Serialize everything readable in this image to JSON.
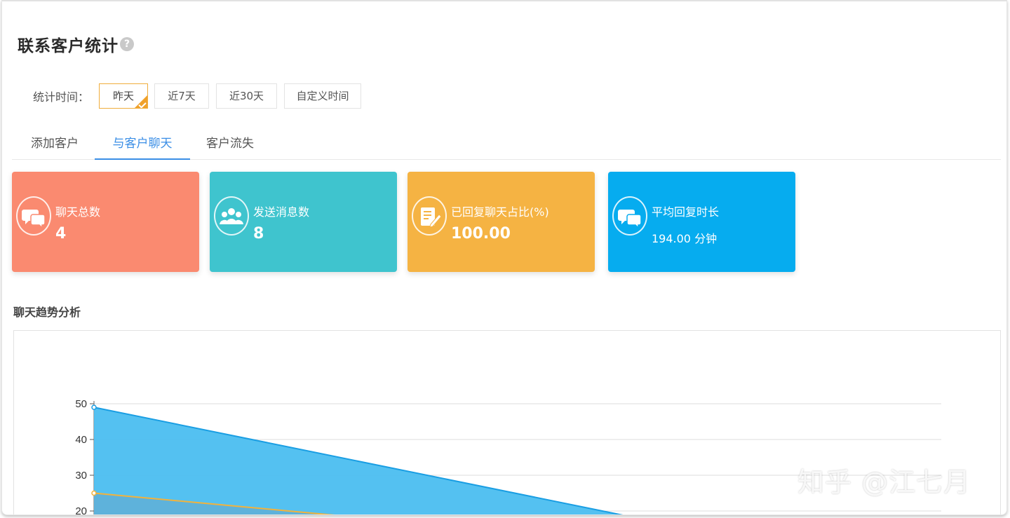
{
  "page": {
    "title": "联系客户统计",
    "help_icon": "?"
  },
  "filter": {
    "label": "统计时间：",
    "options": [
      "昨天",
      "近7天",
      "近30天",
      "自定义时间"
    ],
    "selected": "昨天"
  },
  "tabs": [
    {
      "label": "添加客户",
      "active": false
    },
    {
      "label": "与客户聊天",
      "active": true
    },
    {
      "label": "客户流失",
      "active": false
    }
  ],
  "cards": [
    {
      "label": "聊天总数",
      "value": "4",
      "icon": "chat-bubbles-icon",
      "color": "#fa8a70"
    },
    {
      "label": "发送消息数",
      "value": "8",
      "icon": "people-group-icon",
      "color": "#3fc4ce"
    },
    {
      "label": "已回复聊天占比(%)",
      "value": "100.00",
      "icon": "edit-document-icon",
      "color": "#f5b343"
    },
    {
      "label": "平均回复时长",
      "value": "194.00 分钟",
      "icon": "chat-bubbles-icon",
      "color": "#06acef"
    }
  ],
  "section": {
    "title": "聊天趋势分析"
  },
  "chart_data": {
    "type": "area",
    "y_ticks": [
      20,
      30,
      40,
      50
    ],
    "ylim": [
      0,
      50
    ],
    "grid": true,
    "series": [
      {
        "color": "#4bbef0",
        "stroke": "#1a9ee3",
        "points": [
          [
            0,
            49
          ],
          [
            0.6,
            20
          ]
        ]
      },
      {
        "color": "#5fb0d8",
        "stroke": "#f2b23c",
        "points": [
          [
            0,
            25
          ],
          [
            0.23,
            20
          ]
        ]
      }
    ]
  },
  "watermark": "知乎 @江七月"
}
